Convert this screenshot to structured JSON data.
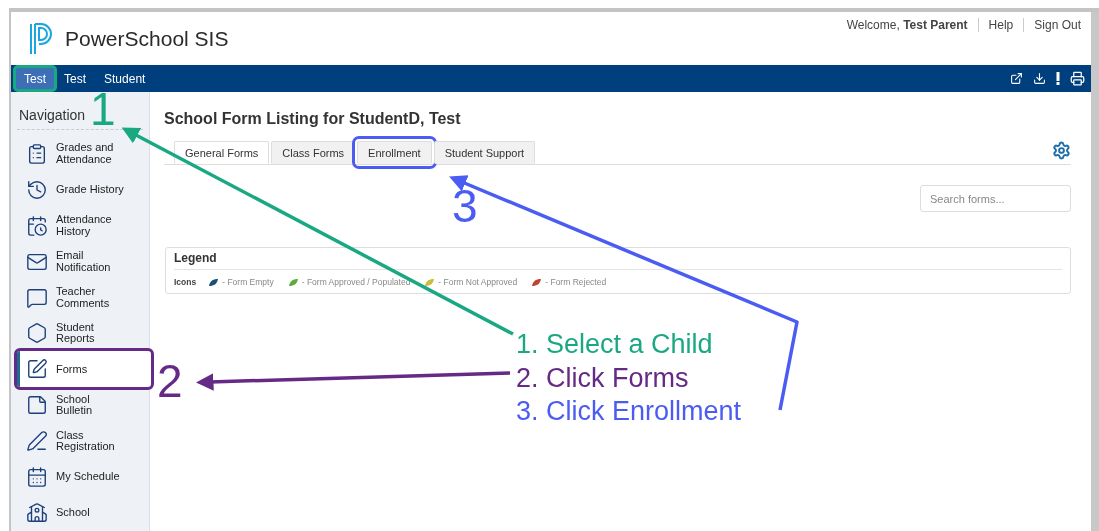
{
  "header": {
    "brand": "PowerSchool SIS",
    "welcome": "Welcome,",
    "user": "Test Parent",
    "links": [
      "Help",
      "Sign Out"
    ]
  },
  "nav_tabs": [
    {
      "label": "Test",
      "selected": true,
      "highlighted": true
    },
    {
      "label": "Test",
      "selected": false,
      "highlighted": false
    },
    {
      "label": "Student",
      "selected": false,
      "highlighted": false
    }
  ],
  "sidebar": {
    "title": "Navigation",
    "items": [
      {
        "label": "Grades and Attendance",
        "selected": false,
        "highlighted": false
      },
      {
        "label": "Grade History",
        "selected": false,
        "highlighted": false
      },
      {
        "label": "Attendance History",
        "selected": false,
        "highlighted": false
      },
      {
        "label": "Email Notification",
        "selected": false,
        "highlighted": false
      },
      {
        "label": "Teacher Comments",
        "selected": false,
        "highlighted": false
      },
      {
        "label": "Student Reports",
        "selected": false,
        "highlighted": false
      },
      {
        "label": "Forms",
        "selected": true,
        "highlighted": true
      },
      {
        "label": "School Bulletin",
        "selected": false,
        "highlighted": false
      },
      {
        "label": "Class Registration",
        "selected": false,
        "highlighted": false
      },
      {
        "label": "My Schedule",
        "selected": false,
        "highlighted": false
      },
      {
        "label": "School",
        "selected": false,
        "highlighted": false
      }
    ]
  },
  "content": {
    "title": "School Form Listing for StudentD, Test",
    "tabs": [
      {
        "label": "General Forms",
        "selected": true,
        "highlighted": false
      },
      {
        "label": "Class Forms",
        "selected": false,
        "highlighted": false
      },
      {
        "label": "Enrollment",
        "selected": false,
        "highlighted": true
      },
      {
        "label": "Student Support",
        "selected": false,
        "highlighted": false
      }
    ],
    "search": {
      "placeholder": "Search forms..."
    },
    "legend": {
      "title": "Legend",
      "label": "Icons",
      "items": [
        {
          "text": "- Form Empty",
          "color": "#1d4f72"
        },
        {
          "text": "- Form Approved / Populated",
          "color": "#5aad3c"
        },
        {
          "text": "- Form Not Approved",
          "color": "#cdbb3a"
        },
        {
          "text": "- Form Rejected",
          "color": "#c0452f"
        }
      ]
    }
  },
  "annotations": {
    "markers": [
      {
        "label": "1",
        "color": "#19a882"
      },
      {
        "label": "2",
        "color": "#652a86"
      },
      {
        "label": "3",
        "color": "#4a5cf2"
      }
    ],
    "steps": [
      {
        "text": "1. Select a Child",
        "color": "#19a882"
      },
      {
        "text": "2. Click Forms",
        "color": "#652a86"
      },
      {
        "text": "3. Click Enrollment",
        "color": "#4a5cf2"
      }
    ]
  }
}
